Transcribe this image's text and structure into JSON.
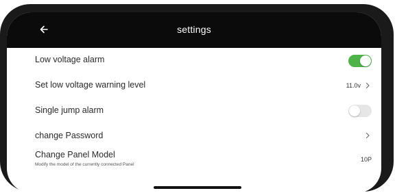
{
  "header": {
    "title": "settings",
    "back_icon": "arrow-left-icon"
  },
  "settings": {
    "low_voltage_alarm": {
      "label": "Low voltage alarm",
      "toggle_on": true,
      "toggle_color": "#4fb34a"
    },
    "low_voltage_warning_level": {
      "label": "Set low voltage warning level",
      "value": "11.0v",
      "chevron_icon": "chevron-right-icon"
    },
    "single_jump_alarm": {
      "label": "Single jump alarm",
      "toggle_on": false
    },
    "change_password": {
      "label": "change Password",
      "chevron_icon": "chevron-right-icon"
    },
    "change_panel_model": {
      "label": "Change Panel Model",
      "sublabel": "Modify the model of the currently connected Panel",
      "value": "10P"
    }
  }
}
